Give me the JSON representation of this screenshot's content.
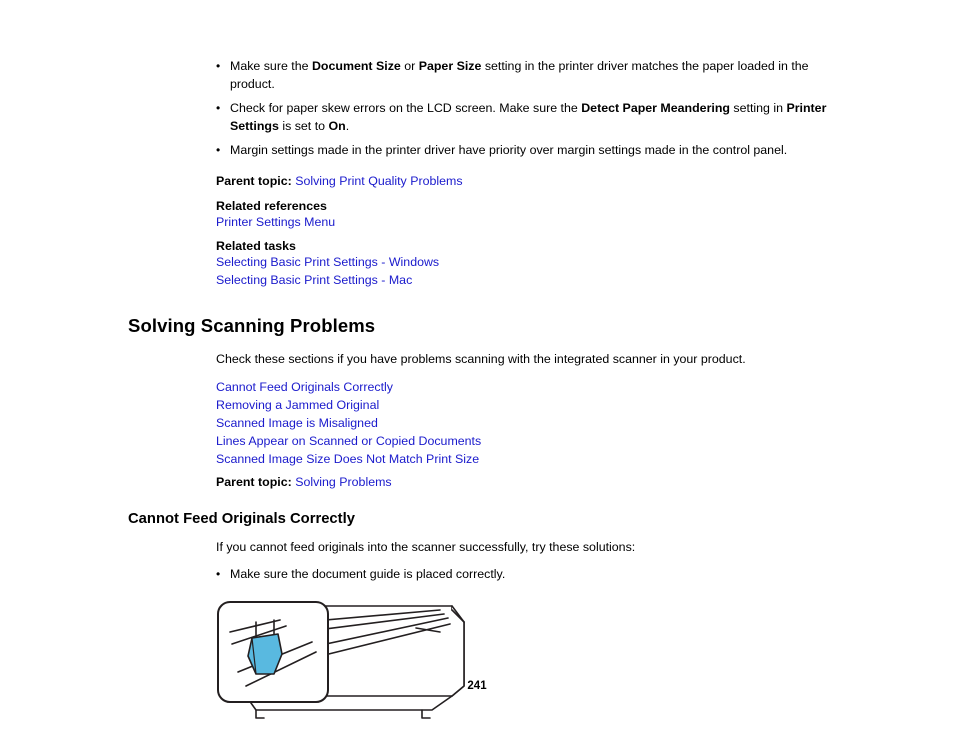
{
  "page": {
    "number": "241"
  },
  "bullets": [
    {
      "parts": [
        {
          "text": "Make sure the ",
          "bold": false
        },
        {
          "text": "Document Size",
          "bold": true
        },
        {
          "text": " or ",
          "bold": false
        },
        {
          "text": "Paper Size",
          "bold": true
        },
        {
          "text": " setting in the printer driver matches the paper loaded in the product.",
          "bold": false
        }
      ]
    },
    {
      "parts": [
        {
          "text": "Check for paper skew errors on the LCD screen. Make sure the ",
          "bold": false
        },
        {
          "text": "Detect Paper Meandering",
          "bold": true
        },
        {
          "text": " setting in ",
          "bold": false
        },
        {
          "text": "Printer Settings",
          "bold": true
        },
        {
          "text": " is set to ",
          "bold": false
        },
        {
          "text": "On",
          "bold": true
        },
        {
          "text": ".",
          "bold": false
        }
      ]
    },
    {
      "parts": [
        {
          "text": "Margin settings made in the printer driver have priority over margin settings made in the control panel.",
          "bold": false
        }
      ]
    }
  ],
  "parent_topic_1": {
    "label": "Parent topic:",
    "link": "Solving Print Quality Problems"
  },
  "related_references": {
    "heading": "Related references",
    "links": [
      "Printer Settings Menu"
    ]
  },
  "related_tasks": {
    "heading": "Related tasks",
    "links": [
      "Selecting Basic Print Settings - Windows",
      "Selecting Basic Print Settings - Mac"
    ]
  },
  "section": {
    "title": "Solving Scanning Problems",
    "intro": "Check these sections if you have problems scanning with the integrated scanner in your product.",
    "topic_links": [
      "Cannot Feed Originals Correctly",
      "Removing a Jammed Original",
      "Scanned Image is Misaligned",
      "Lines Appear on Scanned or Copied Documents",
      "Scanned Image Size Does Not Match Print Size"
    ],
    "parent_topic": {
      "label": "Parent topic:",
      "link": "Solving Problems"
    }
  },
  "subsection": {
    "title": "Cannot Feed Originals Correctly",
    "intro": "If you cannot feed originals into the scanner successfully, try these solutions:",
    "bullets": [
      "Make sure the document guide is placed correctly."
    ],
    "figure_alt": "printer-scanner-document-guide-illustration"
  },
  "colors": {
    "link": "#1a1acc",
    "highlight": "#59b9e0",
    "outline": "#231f20"
  }
}
